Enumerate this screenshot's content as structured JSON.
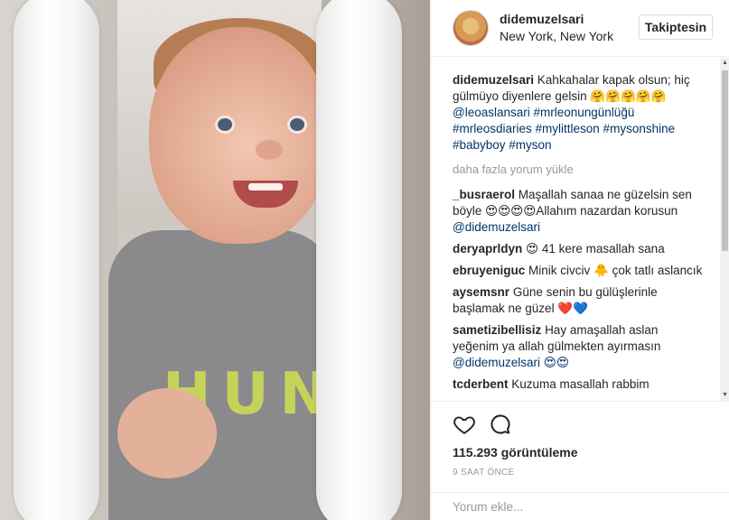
{
  "post": {
    "username": "didemuzelsari",
    "location": "New York, New York",
    "follow_label": "Takiptesin",
    "caption": {
      "username": "didemuzelsari",
      "text": "Kahkahalar kapak olsun; hiç gülmüyo diyenlere gelsin 🤗🤗🤗🤗🤗",
      "tags": "@leoaslansari #mrleonungünlüğü #mrleosdiaries #mylittleson #mysonshine #babyboy #myson"
    },
    "load_more": "daha fazla yorum yükle",
    "comments": [
      {
        "user": "_busraerol",
        "text": "Maşallah sanaa ne güzelsin sen böyle 😍😍😍😍Allahım nazardan korusun",
        "mention": "@didemuzelsari"
      },
      {
        "user": "deryaprldyn",
        "text": "😍 41 kere masallah sana",
        "mention": ""
      },
      {
        "user": "ebruyeniguc",
        "text": "Minik civciv 🐥 çok tatlı aslancık",
        "mention": ""
      },
      {
        "user": "aysemsnr",
        "text": "Güne senin bu gülüşlerinle başlamak ne güzel ❤️💙",
        "mention": ""
      },
      {
        "user": "sametizibellisiz",
        "text": "Hay amaşallah aslan yeğenim ya allah gülmekten ayırmasın",
        "mention": "@didemuzelsari 😍😍"
      },
      {
        "user": "tcderbent",
        "text": "Kuzuma masallah rabbim",
        "mention": ""
      }
    ],
    "views": "115.293 görüntüleme",
    "time": "9 SAAT ÖNCE",
    "comment_placeholder": "Yorum ekle...",
    "photo_shirt_text": "HUNK"
  },
  "icons": {
    "like": "heart-icon",
    "comment": "speech-bubble-icon"
  },
  "colors": {
    "link": "#003569",
    "muted": "#999999",
    "text": "#262626"
  }
}
